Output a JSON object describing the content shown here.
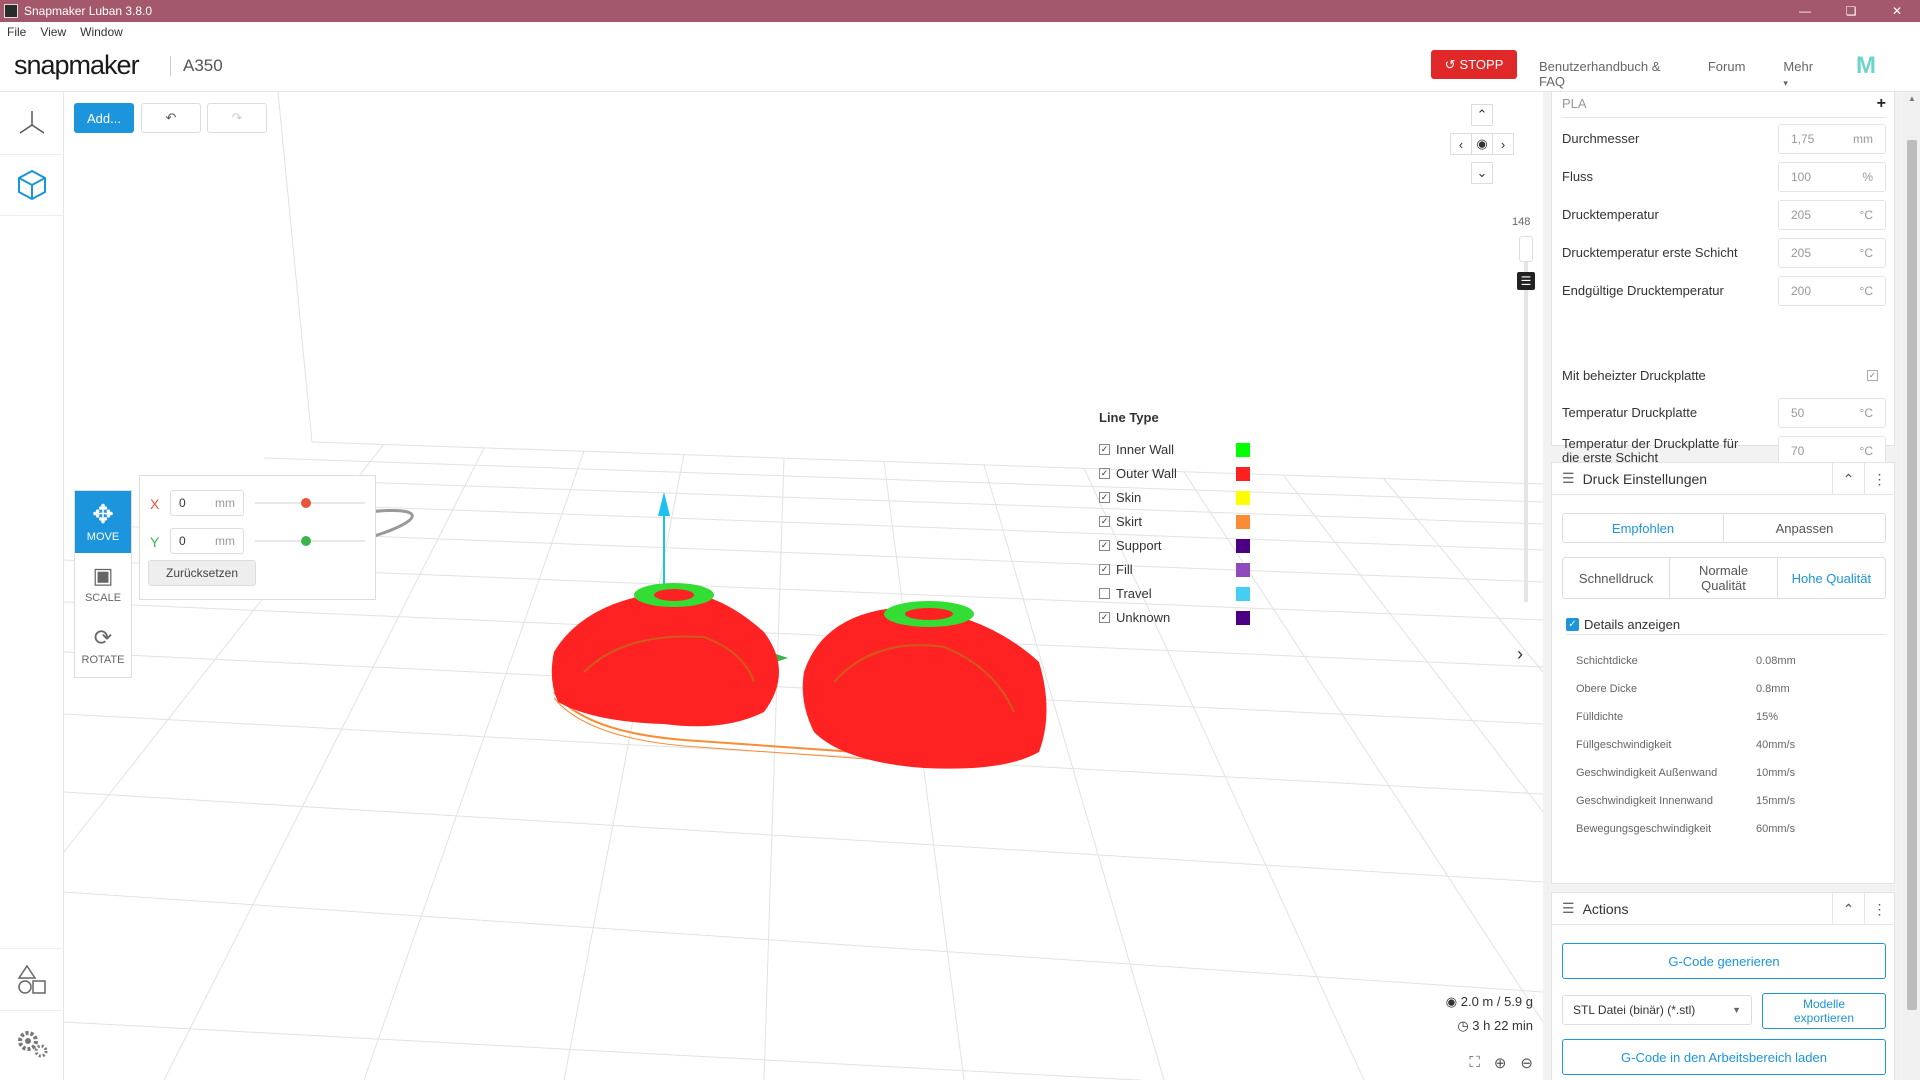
{
  "window": {
    "title": "Snapmaker Luban 3.8.0",
    "menu": [
      "File",
      "View",
      "Window"
    ]
  },
  "header": {
    "logo": "snapmaker",
    "model": "A350",
    "stop_label": "STOPP",
    "links": [
      "Benutzerhandbuch & FAQ",
      "Forum",
      "Mehr"
    ],
    "more_caret": "▾"
  },
  "toolbar": {
    "add_label": "Add..."
  },
  "transform": {
    "tools": [
      {
        "label": "MOVE"
      },
      {
        "label": "SCALE"
      },
      {
        "label": "ROTATE"
      }
    ],
    "x_label": "X",
    "x_value": "0",
    "y_label": "Y",
    "y_value": "0",
    "unit": "mm",
    "reset_label": "Zurücksetzen",
    "x_color": "#e8543a",
    "y_color": "#3cb44b"
  },
  "layer_slider": {
    "value": "148"
  },
  "legend": {
    "title": "Line Type",
    "items": [
      {
        "name": "Inner Wall",
        "checked": true,
        "color": "#00ff00"
      },
      {
        "name": "Outer Wall",
        "checked": true,
        "color": "#ff2020"
      },
      {
        "name": "Skin",
        "checked": true,
        "color": "#ffff00"
      },
      {
        "name": "Skirt",
        "checked": true,
        "color": "#fa8c35"
      },
      {
        "name": "Support",
        "checked": true,
        "color": "#4b0082"
      },
      {
        "name": "Fill",
        "checked": true,
        "color": "#8d4bbb"
      },
      {
        "name": "Travel",
        "checked": false,
        "color": "#44cef6"
      },
      {
        "name": "Unknown",
        "checked": true,
        "color": "#4b0082"
      }
    ]
  },
  "stats": {
    "filament": "2.0 m / 5.9 g",
    "time": "3 h 22 min"
  },
  "material": {
    "name": "PLA",
    "rows": [
      {
        "label": "Durchmesser",
        "value": "1,75",
        "unit": "mm"
      },
      {
        "label": "Fluss",
        "value": "100",
        "unit": "%"
      },
      {
        "label": "Drucktemperatur",
        "value": "205",
        "unit": "°C"
      },
      {
        "label": "Drucktemperatur erste Schicht",
        "value": "205",
        "unit": "°C"
      },
      {
        "label": "Endgültige Drucktemperatur",
        "value": "200",
        "unit": "°C"
      }
    ],
    "heated_label": "Mit beheizter Druckplatte",
    "bed_rows": [
      {
        "label": "Temperatur Druckplatte",
        "value": "50",
        "unit": "°C"
      },
      {
        "label": "Temperatur der Druckplatte für die erste Schicht",
        "value": "70",
        "unit": "°C"
      }
    ]
  },
  "print_settings": {
    "title": "Druck Einstellungen",
    "tabs": [
      "Empfohlen",
      "Anpassen"
    ],
    "presets": [
      "Schnelldruck",
      "Normale Qualität",
      "Hohe Qualität"
    ],
    "details_label": "Details anzeigen",
    "details": [
      {
        "k": "Schichtdicke",
        "v": "0.08mm"
      },
      {
        "k": "Obere Dicke",
        "v": "0.8mm"
      },
      {
        "k": "Fülldichte",
        "v": "15%"
      },
      {
        "k": "Füllgeschwindigkeit",
        "v": "40mm/s"
      },
      {
        "k": "Geschwindigkeit Außenwand",
        "v": "10mm/s"
      },
      {
        "k": "Geschwindigkeit Innenwand",
        "v": "15mm/s"
      },
      {
        "k": "Bewegungsgeschwindigkeit",
        "v": "60mm/s"
      }
    ]
  },
  "actions": {
    "title": "Actions",
    "generate_label": "G-Code generieren",
    "format_value": "STL Datei (binär) (*.stl)",
    "export_label": "Modelle exportieren",
    "load_label": "G-Code in den Arbeitsbereich laden"
  }
}
